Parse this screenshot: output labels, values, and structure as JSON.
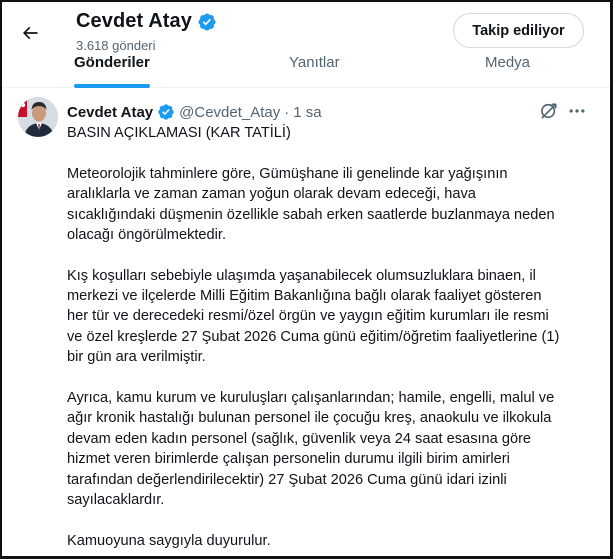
{
  "header": {
    "title": "Cevdet Atay",
    "posts_count": "3.618 gönderi",
    "follow_button": "Takip ediliyor"
  },
  "tabs": [
    {
      "label": "Gönderiler",
      "active": true
    },
    {
      "label": "Yanıtlar",
      "active": false
    },
    {
      "label": "Medya",
      "active": false
    }
  ],
  "tweet": {
    "author_name": "Cevdet Atay",
    "handle": "@Cevdet_Atay",
    "separator": "·",
    "time": "1 sa",
    "title_line": "BASIN AÇIKLAMASI (KAR TATİLİ)",
    "paragraph1_lines": [
      "Meteorolojik tahminlere göre, Gümüşhane ili genelinde kar yağışının",
      "aralıklarla ve zaman zaman yoğun olarak devam edeceği, hava",
      "sıcaklığındaki düşmenin özellikle sabah erken saatlerde buzlanmaya neden",
      "olacağı öngörülmektedir."
    ],
    "paragraph2_lines": [
      "Kış koşulları sebebiyle ulaşımda yaşanabilecek olumsuzluklara binaen, il",
      "merkezi ve ilçelerde Milli Eğitim Bakanlığına bağlı olarak faaliyet gösteren",
      "her tür ve derecedeki resmi/özel örgün ve yaygın eğitim kurumları ile resmi",
      "ve özel kreşlerde 27 Şubat 2026 Cuma günü eğitim/öğretim faaliyetlerine (1)",
      "bir gün ara verilmiştir."
    ],
    "paragraph3_lines": [
      "Ayrıca, kamu kurum ve kuruluşları çalışanlarından; hamile, engelli, malul ve",
      "ağır kronik hastalığı bulunan personel ile çocuğu kreş, anaokulu ve ilkokula",
      "devam eden kadın personel (sağlık, güvenlik veya 24 saat esasına göre",
      "hizmet veren birimlerde çalışan personelin durumu ilgili birim amirleri",
      "tarafından değerlendirilecektir) 27 Şubat 2026 Cuma günü idari izinli",
      "sayılacaklardır."
    ],
    "paragraph4_lines": [
      "Kamuoyuna saygıyla duyurulur."
    ]
  },
  "colors": {
    "accent": "#1d9bf0",
    "text_primary": "#0f1419",
    "text_secondary": "#536471",
    "border": "#cfd9de"
  },
  "icons": {
    "back": "arrow-left-icon",
    "verified": "verified-badge-icon",
    "grok": "grok-icon",
    "more": "more-horizontal-icon"
  }
}
